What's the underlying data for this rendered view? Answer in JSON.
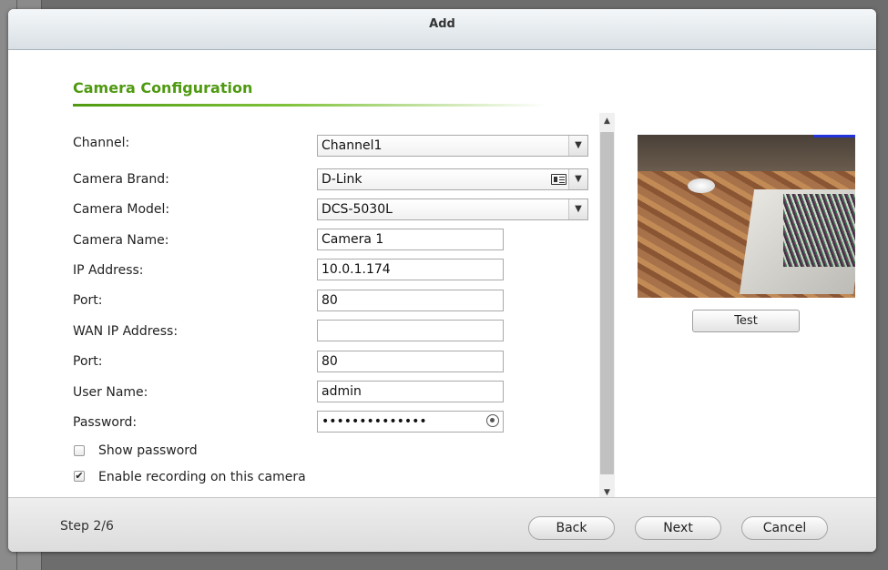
{
  "dialog": {
    "title": "Add"
  },
  "section": {
    "title": "Camera Configuration"
  },
  "form": {
    "channel": {
      "label": "Channel:",
      "value": "Channel1"
    },
    "brand": {
      "label": "Camera Brand:",
      "value": "D-Link"
    },
    "model": {
      "label": "Camera Model:",
      "value": "DCS-5030L"
    },
    "name": {
      "label": "Camera Name:",
      "value": "Camera 1"
    },
    "ip": {
      "label": "IP Address:",
      "value": "10.0.1.174"
    },
    "port": {
      "label": "Port:",
      "value": "80"
    },
    "wan_ip": {
      "label": "WAN IP Address:",
      "value": ""
    },
    "wan_port": {
      "label": "Port:",
      "value": "80"
    },
    "username": {
      "label": "User Name:",
      "value": "admin"
    },
    "password": {
      "label": "Password:",
      "value": "••••••••••••••"
    },
    "show_password": {
      "label": "Show password",
      "checked": false
    },
    "enable_recording": {
      "label": "Enable recording on this camera",
      "checked": true
    }
  },
  "preview": {
    "test_label": "Test"
  },
  "footer": {
    "step": "Step 2/6",
    "back_label": "Back",
    "next_label": "Next",
    "cancel_label": "Cancel"
  },
  "icons": {
    "dropdown": "chevron-down-icon",
    "brand_list": "list-card-icon",
    "password_reveal": "eye-icon",
    "checkmark": "checkmark-icon"
  },
  "colors": {
    "accent_green": "#4f9a10"
  }
}
